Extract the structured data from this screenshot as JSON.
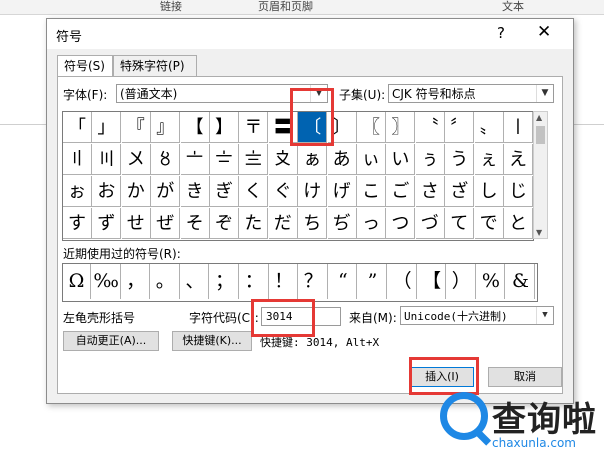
{
  "background": {
    "ribbon": [
      "链接",
      "页眉和页脚",
      "文本"
    ]
  },
  "dialog": {
    "title": "符号",
    "help": "?",
    "close": "✕",
    "tabs": [
      "符号(S)",
      "特殊字符(P)"
    ],
    "font_label": "字体(F):",
    "font_value": "(普通文本)",
    "subset_label": "子集(U):",
    "subset_value": "CJK 符号和标点",
    "grid": [
      [
        "「",
        "」",
        "『",
        "』",
        "【",
        "】",
        "〒",
        "〓",
        "〔",
        "〕",
        "〖",
        "〗",
        "〝",
        "〞",
        "〟",
        "〡"
      ],
      [
        "〢",
        "〣",
        "〤",
        "〥",
        "〦",
        "〧",
        "〨",
        "〩",
        "ぁ",
        "あ",
        "ぃ",
        "い",
        "ぅ",
        "う",
        "ぇ",
        "え"
      ],
      [
        "ぉ",
        "お",
        "か",
        "が",
        "き",
        "ぎ",
        "く",
        "ぐ",
        "け",
        "げ",
        "こ",
        "ご",
        "さ",
        "ざ",
        "し",
        "じ"
      ],
      [
        "す",
        "ず",
        "せ",
        "ぜ",
        "そ",
        "ぞ",
        "た",
        "だ",
        "ち",
        "ぢ",
        "っ",
        "つ",
        "づ",
        "て",
        "で",
        "と"
      ]
    ],
    "selected_symbol": "〔",
    "recent_label": "近期使用过的符号(R):",
    "recent": [
      "Ω",
      "‰",
      "，",
      "。",
      "、",
      "；",
      "：",
      "！",
      "？",
      "“",
      "”",
      "（",
      "【",
      "）",
      "%",
      "&"
    ],
    "symbol_name": "左龟壳形括号",
    "char_code_label": "字符代码(C):",
    "char_code_value": "3014",
    "from_label": "来自(M):",
    "from_value": "Unicode(十六进制)",
    "autocorrect_label": "自动更正(A)...",
    "shortcut_key_label": "快捷键(K)...",
    "shortcut_text": "快捷键: 3014, Alt+X",
    "insert_label": "插入(I)",
    "cancel_label": "取消"
  },
  "watermark": {
    "text": "查询啦",
    "url": "chaxunla.com"
  },
  "colors": {
    "selection": "#0063b1",
    "highlight_box": "#e53935",
    "watermark_blue": "#1e88e5"
  }
}
